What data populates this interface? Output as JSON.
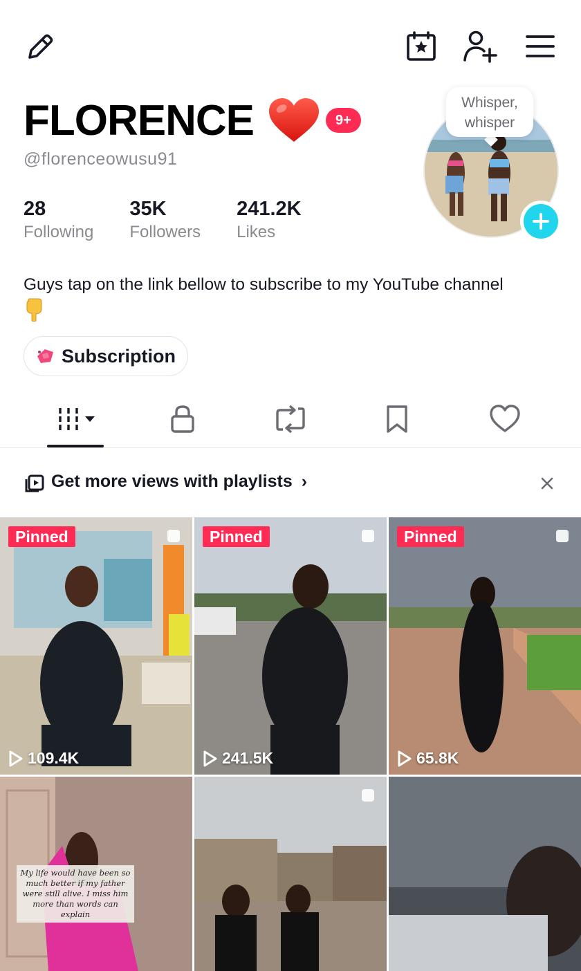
{
  "profile": {
    "name": "FLORENCE",
    "notification_badge": "9+",
    "handle": "@florenceowusu91",
    "bubble_text": "Whisper, whisper",
    "bio": "Guys tap on the link bellow to subscribe to my YouTube channel",
    "subscription_label": "Subscription"
  },
  "stats": [
    {
      "value": "28",
      "label": "Following"
    },
    {
      "value": "35K",
      "label": "Followers"
    },
    {
      "value": "241.2K",
      "label": "Likes"
    }
  ],
  "icons": {
    "edit": "pencil-icon",
    "calendar": "calendar-star-icon",
    "add_user": "add-user-icon",
    "menu": "hamburger-menu-icon",
    "avatar_add": "plus-icon",
    "tabs": [
      "grid-icon",
      "lock-icon",
      "repost-icon",
      "bookmark-icon",
      "heart-icon"
    ],
    "playlist": "playlist-icon",
    "close": "close-icon"
  },
  "colors": {
    "accent": "#fe2c55",
    "avatar_add": "#20d5ec",
    "text": "#161823",
    "muted": "#8a8b91"
  },
  "playlist_banner": {
    "text": "Get more views with playlists",
    "chevron": "›"
  },
  "videos": [
    {
      "pinned_label": "Pinned",
      "views": "109.4K"
    },
    {
      "pinned_label": "Pinned",
      "views": "241.5K"
    },
    {
      "pinned_label": "Pinned",
      "views": "65.8K"
    },
    {
      "caption": "My life would have been so much better if my father were still alive. I miss him more than words can explain"
    },
    {},
    {}
  ]
}
